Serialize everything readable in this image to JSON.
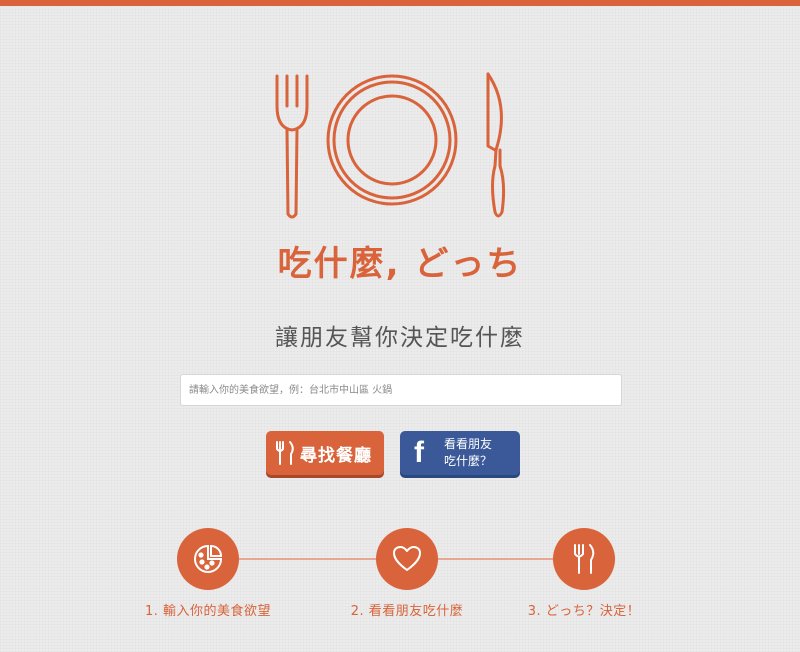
{
  "brand": {
    "title": "吃什麼, どっち",
    "tagline": "讓朋友幫你決定吃什麼",
    "accent_color": "#d9633a",
    "logo_icon": "fork-plate-knife-icon"
  },
  "search": {
    "value": "",
    "placeholder": "請輸入你的美食欲望，例：台北市中山區 火鍋"
  },
  "buttons": {
    "find_restaurants": {
      "icon": "fork-knife-icon",
      "label": "尋找餐廳"
    },
    "facebook": {
      "icon": "facebook-icon",
      "line1": "看看朋友",
      "line2": "吃什麼？",
      "color": "#3b5998"
    }
  },
  "steps": [
    {
      "icon": "pizza-icon",
      "label": "1. 輸入你的美食欲望"
    },
    {
      "icon": "heart-icon",
      "label": "2. 看看朋友吃什麼"
    },
    {
      "icon": "fork-knife-icon",
      "label": "3. どっち？決定！"
    }
  ]
}
